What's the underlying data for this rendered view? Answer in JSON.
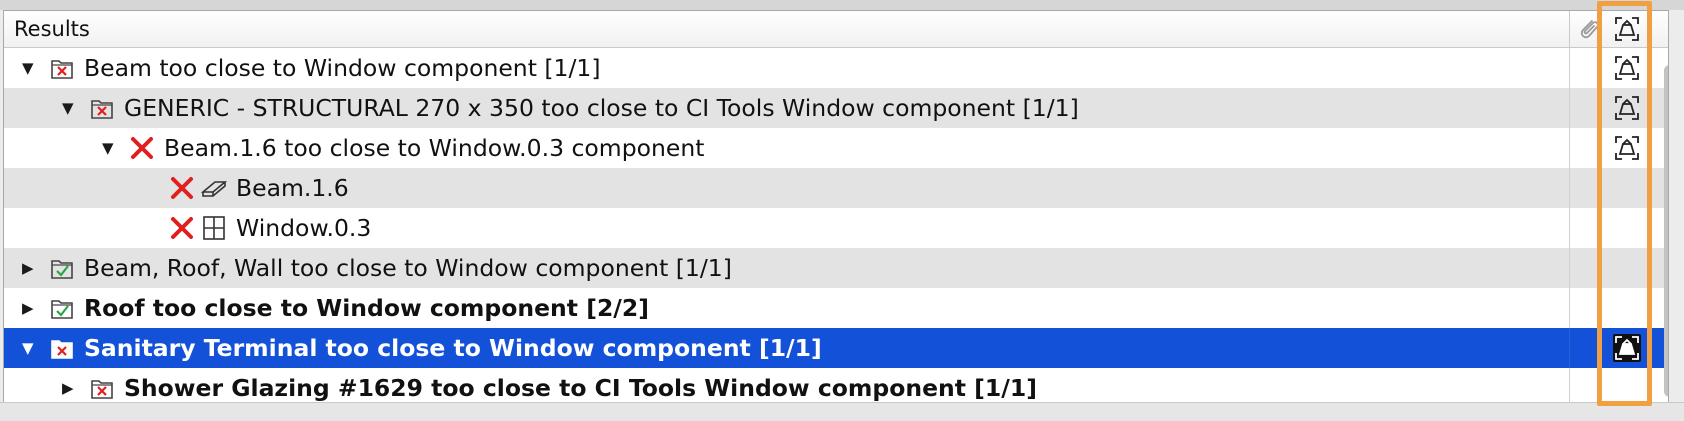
{
  "table": {
    "header_title": "Results",
    "columns": [
      "Results",
      "link",
      "view"
    ]
  },
  "rows": [
    {
      "label": "Beam too close to Window component [1/1]",
      "expanded": true,
      "status": "fail-folder",
      "bold": false,
      "selected": false,
      "has_view": true
    },
    {
      "label": "GENERIC - STRUCTURAL 270 x 350 too close to CI Tools Window component [1/1]",
      "expanded": true,
      "status": "fail-folder",
      "bold": false,
      "selected": false,
      "has_view": true
    },
    {
      "label": "Beam.1.6 too close to Window.0.3 component",
      "expanded": true,
      "status": "fail-x",
      "bold": false,
      "selected": false,
      "has_view": true
    },
    {
      "label": "Beam.1.6",
      "status": "fail-x",
      "object_icon": "beam-icon",
      "bold": false,
      "selected": false,
      "has_view": false
    },
    {
      "label": "Window.0.3",
      "status": "fail-x",
      "object_icon": "window-icon",
      "bold": false,
      "selected": false,
      "has_view": false
    },
    {
      "label": "Beam, Roof, Wall too close to Window component [1/1]",
      "expanded": false,
      "status": "pass-folder",
      "bold": false,
      "selected": false,
      "has_view": false
    },
    {
      "label": "Roof too close to Window component [2/2]",
      "expanded": false,
      "status": "pass-folder",
      "bold": true,
      "selected": false,
      "has_view": false
    },
    {
      "label": "Sanitary Terminal too close to Window component [1/1]",
      "expanded": true,
      "status": "fail-folder",
      "bold": true,
      "selected": true,
      "has_view": true
    },
    {
      "label": "Shower Glazing #1629 too close to CI Tools Window component [1/1]",
      "expanded": false,
      "status": "fail-folder",
      "bold": true,
      "selected": false,
      "has_view": false
    }
  ],
  "colors": {
    "selection": "#1352d8",
    "highlight": "#f0a040",
    "fail": "#e02020",
    "pass": "#28a745"
  }
}
